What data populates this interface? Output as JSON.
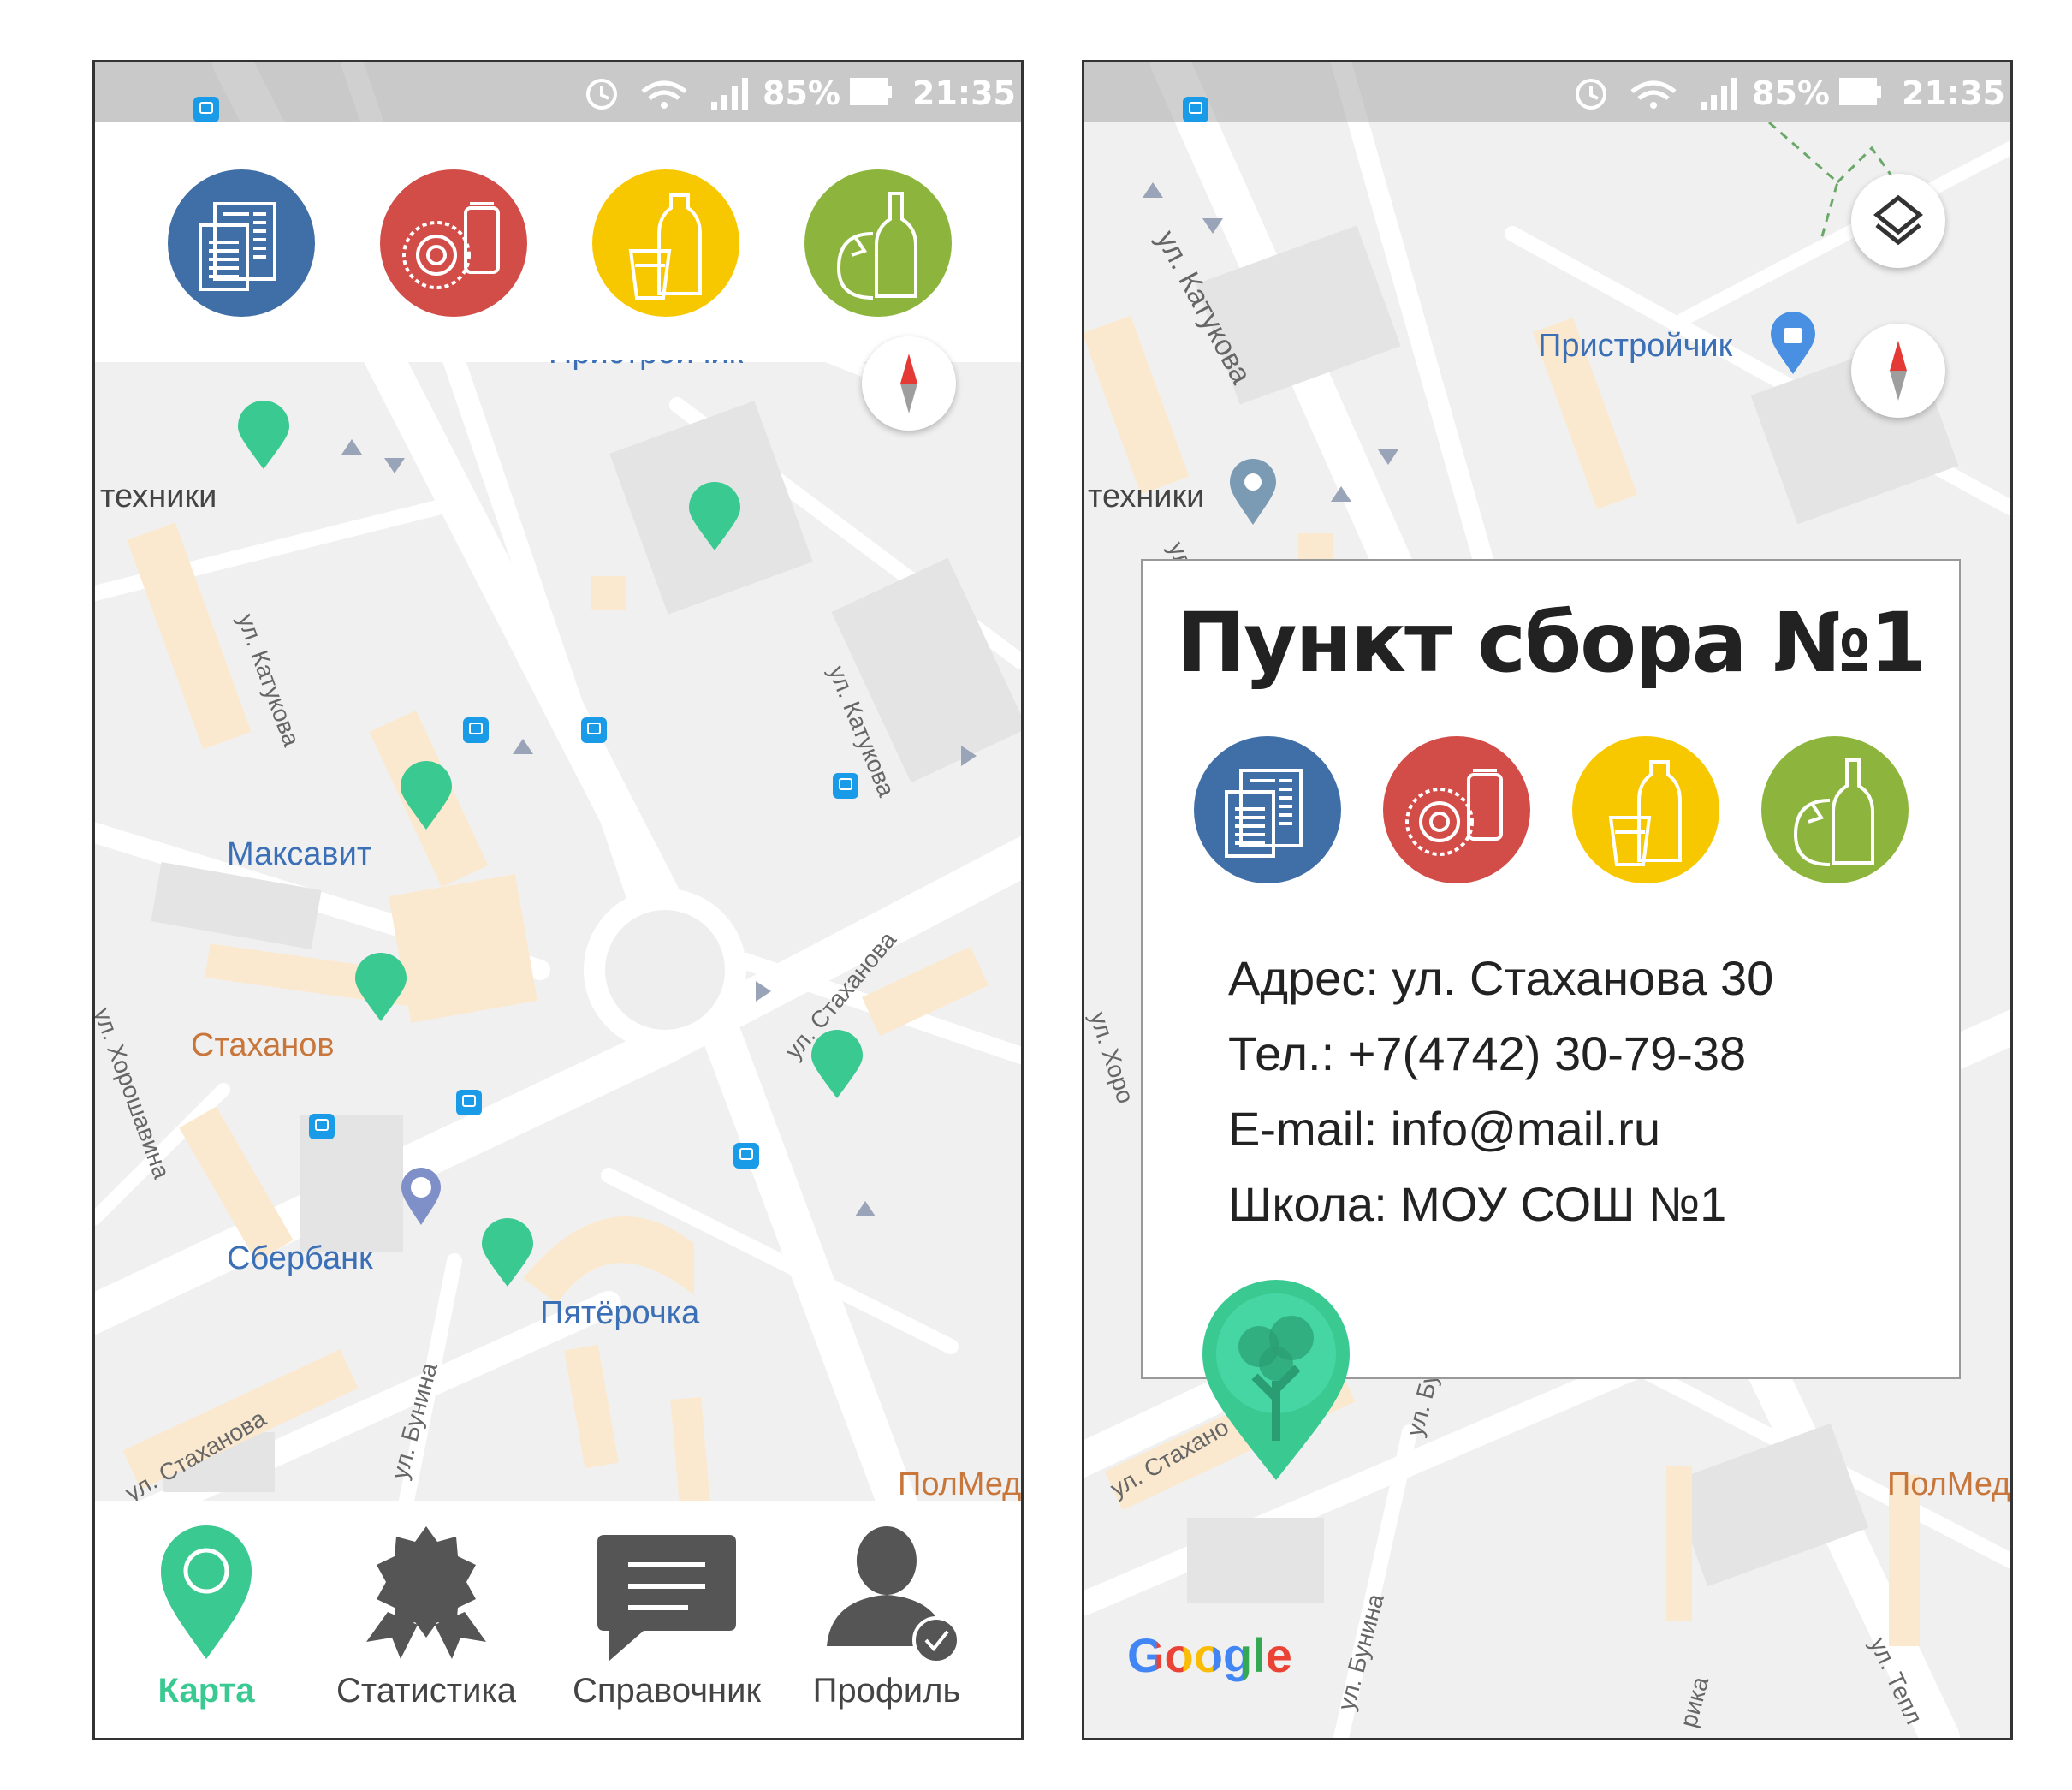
{
  "status_bar": {
    "battery": "85%",
    "time": "21:35"
  },
  "colors": {
    "accent_green": "#3ac991",
    "paper_blue": "#3f6fa6",
    "metal_red": "#d24c48",
    "plastic_yellow": "#f7c800",
    "glass_green": "#8db53d"
  },
  "categories": [
    {
      "icon": "paper-icon",
      "color": "#3f6fa6"
    },
    {
      "icon": "metal-can-icon",
      "color": "#d24c48"
    },
    {
      "icon": "plastic-bottle-icon",
      "color": "#f7c800"
    },
    {
      "icon": "glass-bottle-icon",
      "color": "#8db53d"
    }
  ],
  "map_left": {
    "places": {
      "tech": "техники",
      "maksavit": "Максавит",
      "stakhanov": "Стаханов",
      "sberbank": "Сбербанк",
      "pyaterochka": "Пятёрочка",
      "polmed": "ПолМед",
      "pristroychik": "Пристройчик"
    },
    "streets": {
      "katukova1": "ул. Катукова",
      "katukova2": "ул. Катукова",
      "stakhanova1": "ул. Стаханова",
      "stakhanova2": "ул. Стаханова",
      "khoroshavina": "ул. Хорошавина",
      "bunina": "ул. Бунина"
    }
  },
  "bottom_nav": [
    {
      "label": "Карта",
      "icon": "map-pin-icon",
      "active": true
    },
    {
      "label": "Статистика",
      "icon": "award-badge-icon",
      "active": false
    },
    {
      "label": "Справочник",
      "icon": "chat-bubble-icon",
      "active": false
    },
    {
      "label": "Профиль",
      "icon": "profile-check-icon",
      "active": false
    }
  ],
  "map_right": {
    "places": {
      "pristroychik": "Пристройчик",
      "tech": "техники",
      "polmed": "ПолМед"
    },
    "streets": {
      "katukova": "ул. Катукова",
      "katukova_short": "ул. Кат",
      "khoroshavina": "ул. Хоро",
      "stakhanova": "ул. Стахано",
      "bunina1": "ул. Бу",
      "bunina2": "ул. Бунина",
      "tepl": "ул. Тепл",
      "rika": "рика"
    },
    "google": "Google"
  },
  "info_card": {
    "title": "Пункт сбора №1",
    "address": "Адрес: ул. Стаханова 30",
    "phone": "Тел.: +7(4742) 30-79-38",
    "email": "E-mail: info@mail.ru",
    "school": "Школа: МОУ СОШ №1"
  }
}
